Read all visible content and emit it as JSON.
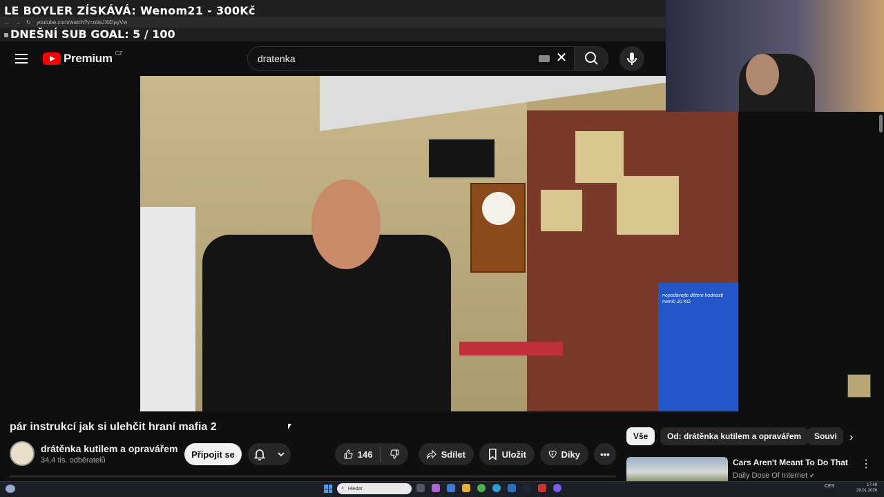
{
  "overlay": {
    "title": "LE BOYLER ZÍSKÁVÁ: Wenom21 - 300Kč",
    "sub_goal": "DNEŠNÍ SUB GOAL: 5 / 100",
    "url": "youtube.com/watch?v=obsJXiDpyVw"
  },
  "header": {
    "logo_text": "Premium",
    "region": "CZ",
    "search_value": "dratenka",
    "icons": [
      "menu-icon",
      "youtube-play-icon",
      "keyboard-icon",
      "clear-icon",
      "search-icon",
      "mic-icon"
    ]
  },
  "video": {
    "poster_text": "nepodávejte dětem hodnosti menší 20 KG"
  },
  "watch": {
    "title": "pár instrukcí jak si ulehčit hraní mafia 2",
    "channel_name": "drátěnka kutilem a opravářem",
    "subscribers": "34,4 tis. odběratelů",
    "subscribe_label": "Připojit se",
    "likes": "146",
    "share_label": "Sdílet",
    "save_label": "Uložit",
    "thanks_label": "Díky",
    "more_label": "•••"
  },
  "chips": [
    "Vše",
    "Od: drátěnka kutilem a opravářem",
    "Souvi"
  ],
  "recommendation": {
    "title": "Cars Aren't Meant To Do That",
    "channel": "Daily Dose Of Internet",
    "verified": "✔"
  },
  "taskbar": {
    "search_placeholder": "Hledat",
    "tray_lang": "CES",
    "time": "17:49",
    "date": "29.01.2026"
  }
}
